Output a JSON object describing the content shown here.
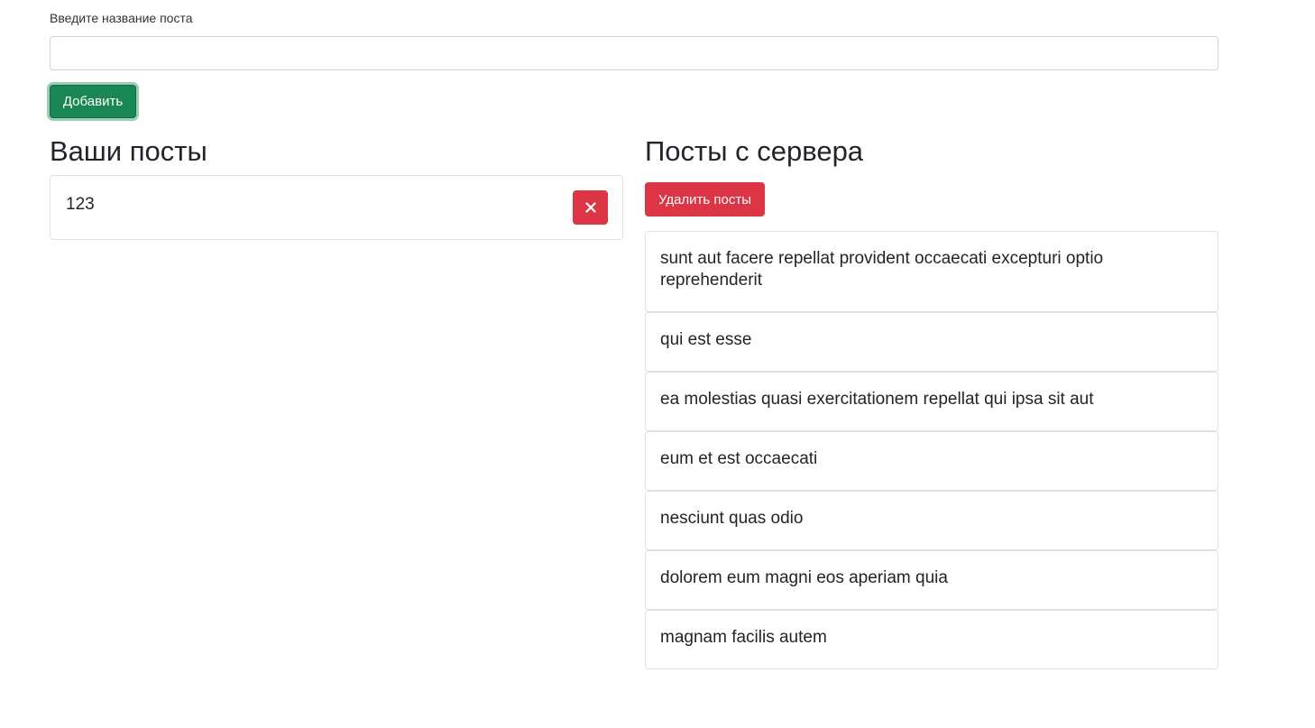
{
  "form": {
    "label": "Введите название поста",
    "input_value": "",
    "input_placeholder": "",
    "add_button_label": "Добавить"
  },
  "your_posts": {
    "title": "Ваши посты",
    "items": [
      {
        "text": "123",
        "delete_icon": "close-icon"
      }
    ]
  },
  "server_posts": {
    "title": "Посты с сервера",
    "remove_button_label": "Удалить посты",
    "items": [
      "sunt aut facere repellat provident occaecati excepturi optio reprehenderit",
      "qui est esse",
      "ea molestias quasi exercitationem repellat qui ipsa sit aut",
      "eum et est occaecati",
      "nesciunt quas odio",
      "dolorem eum magni eos aperiam quia",
      "magnam facilis autem"
    ]
  },
  "colors": {
    "success": "#198754",
    "danger": "#dc3545",
    "border": "#dee2e6",
    "text": "#212529"
  }
}
